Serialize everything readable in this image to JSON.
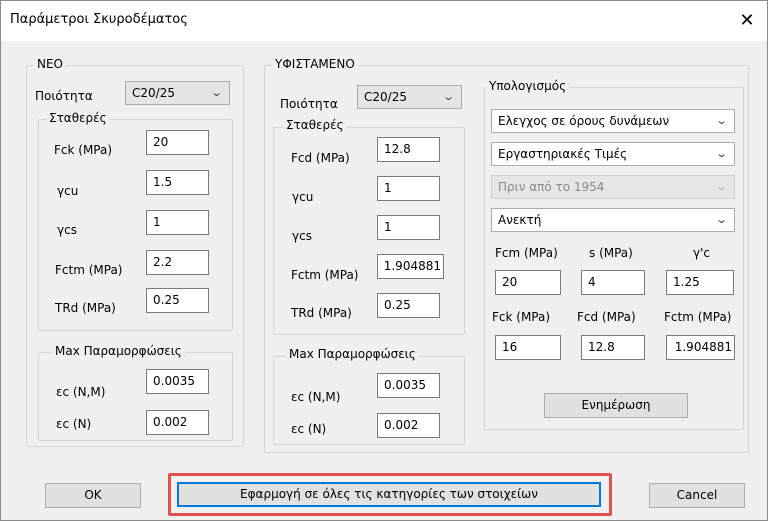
{
  "window": {
    "title": "Παράμετροι Σκυροδέματος",
    "close_glyph": "✕"
  },
  "neo": {
    "group_label": "ΝΕΟ",
    "quality_label": "Ποιότητα",
    "quality_value": "C20/25",
    "constants_label": "Σταθερές",
    "fck_label": "Fck (MPa)",
    "fck_value": "20",
    "gcu_label": "γcu",
    "gcu_value": "1.5",
    "gcs_label": "γcs",
    "gcs_value": "1",
    "fctm_label": "Fctm (MPa)",
    "fctm_value": "2.2",
    "trd_label": "TRd (MPa)",
    "trd_value": "0.25",
    "strain_label": "Max Παραμορφώσεις",
    "ecnm_label": "εc (N,M)",
    "ecnm_value": "0.0035",
    "ecn_label": "εc (N)",
    "ecn_value": "0.002"
  },
  "existing": {
    "group_label": "ΥΦΙΣΤΑΜΕΝΟ",
    "quality_label": "Ποιότητα",
    "quality_value": "C20/25",
    "constants_label": "Σταθερές",
    "fcd_label": "Fcd (MPa)",
    "fcd_value": "12.8",
    "gcu_label": "γcu",
    "gcu_value": "1",
    "gcs_label": "γcs",
    "gcs_value": "1",
    "fctm_label": "Fctm (MPa)",
    "fctm_value": "1.904881",
    "trd_label": "TRd (MPa)",
    "trd_value": "0.25",
    "strain_label": "Max Παραμορφώσεις",
    "ecnm_label": "εc (N,M)",
    "ecnm_value": "0.0035",
    "ecn_label": "εc (N)",
    "ecn_value": "0.002"
  },
  "calc": {
    "group_label": "Υπολογισμός",
    "method_value": "Ελεγχος σε όρους δυνάμεων",
    "source_value": "Εργαστηριακές Τιμές",
    "era_value": "Πριν από το 1954",
    "tolerance_value": "Ανεκτή",
    "fcm_label": "Fcm (MPa)",
    "fcm_value": "20",
    "s_label": "s (MPa)",
    "s_value": "4",
    "gc_label": "γ'c",
    "gc_value": "1.25",
    "fck_label": "Fck (MPa)",
    "fck_value": "16",
    "fcd_label": "Fcd (MPa)",
    "fcd_value": "12.8",
    "fctm_label": "Fctm (MPa)",
    "fctm_value": "1.904881",
    "update_label": "Ενημέρωση"
  },
  "footer": {
    "ok_label": "OK",
    "apply_all_label": "Εφαρμογή σε όλες τις κατηγορίες των στοιχείων",
    "cancel_label": "Cancel"
  },
  "dropdown_glyph": "⌄",
  "colors": {
    "highlight": "#e05050",
    "focus": "#0078d7"
  }
}
